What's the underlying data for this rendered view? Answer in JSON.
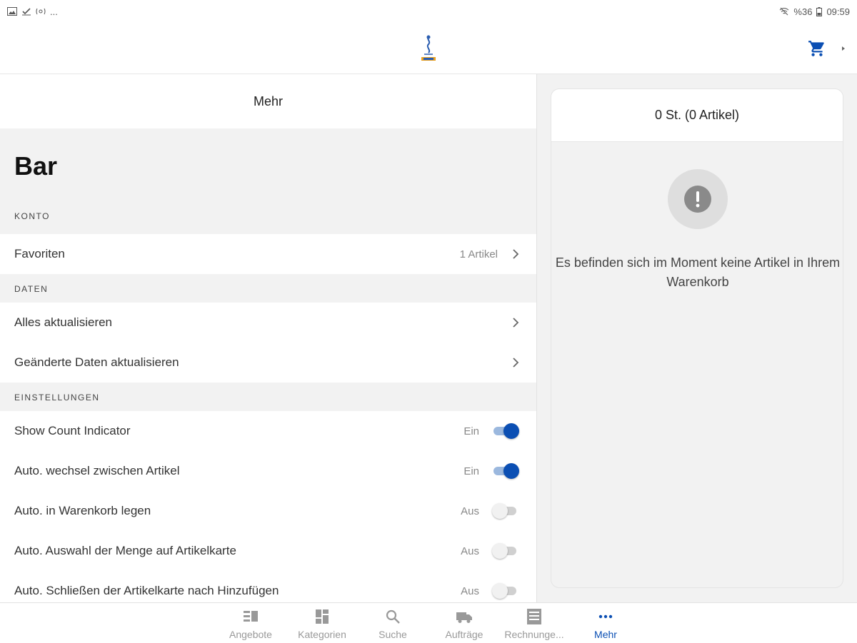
{
  "statusbar": {
    "left_icons": [
      "image-icon",
      "download-done-icon",
      "cast-icon",
      "more-dots-icon"
    ],
    "left_more": "...",
    "battery": "%36",
    "time": "09:59"
  },
  "header": {
    "logo_icon": "app-logo",
    "cart_icon": "cart-icon"
  },
  "left_panel": {
    "title": "Mehr",
    "big_title": "Bar",
    "sections": {
      "konto": "KONTO",
      "daten": "DATEN",
      "einstellungen": "EINSTELLUNGEN"
    },
    "favoriten": {
      "label": "Favoriten",
      "meta": "1 Artikel"
    },
    "alles_aktualisieren": {
      "label": "Alles aktualisieren"
    },
    "geaenderte_daten": {
      "label": "Geänderte Daten aktualisieren"
    },
    "settings": [
      {
        "label": "Show Count Indicator",
        "state": "Ein",
        "on": true
      },
      {
        "label": "Auto. wechsel zwischen Artikel",
        "state": "Ein",
        "on": true
      },
      {
        "label": "Auto. in Warenkorb legen",
        "state": "Aus",
        "on": false
      },
      {
        "label": "Auto. Auswahl der Menge auf Artikelkarte",
        "state": "Aus",
        "on": false
      },
      {
        "label": "Auto. Schließen der Artikelkarte nach Hinzufügen",
        "state": "Aus",
        "on": false
      }
    ]
  },
  "cart": {
    "summary": "0 St. (0 Artikel)",
    "empty_message": "Es befinden sich im Moment keine Artikel in Ihrem Warenkorb",
    "empty_icon": "exclamation-icon"
  },
  "bottom_nav": [
    {
      "label": "Angebote",
      "icon": "list-icon",
      "active": false
    },
    {
      "label": "Kategorien",
      "icon": "grid-icon",
      "active": false
    },
    {
      "label": "Suche",
      "icon": "search-icon",
      "active": false
    },
    {
      "label": "Aufträge",
      "icon": "truck-icon",
      "active": false
    },
    {
      "label": "Rechnunge...",
      "icon": "receipt-icon",
      "active": false
    },
    {
      "label": "Mehr",
      "icon": "more-icon",
      "active": true
    }
  ],
  "colors": {
    "accent": "#0b4fb3",
    "background": "#f2f2f2",
    "toggle_off": "#d0d0d0"
  }
}
